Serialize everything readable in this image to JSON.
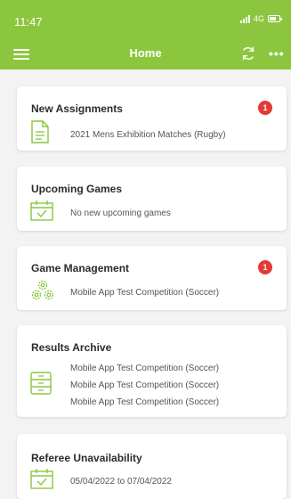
{
  "status_bar": {
    "time": "11:47",
    "network": "4G"
  },
  "header": {
    "title": "Home"
  },
  "colors": {
    "accent": "#8cc63f",
    "badge": "#e53935"
  },
  "cards": [
    {
      "title": "New Assignments",
      "badge": "1",
      "icon": "document-icon",
      "items": [
        "2021 Mens Exhibition Matches (Rugby)"
      ]
    },
    {
      "title": "Upcoming Games",
      "icon": "calendar-check-icon",
      "items": [
        "No new upcoming games"
      ]
    },
    {
      "title": "Game Management",
      "badge": "1",
      "icon": "gears-icon",
      "items": [
        "Mobile App Test Competition (Soccer)"
      ]
    },
    {
      "title": "Results Archive",
      "icon": "archive-icon",
      "items": [
        "Mobile App Test Competition (Soccer)",
        "Mobile App Test Competition (Soccer)",
        "Mobile App Test Competition (Soccer)"
      ]
    },
    {
      "title": "Referee Unavailability",
      "icon": "calendar-check-icon",
      "items": [
        "05/04/2022 to 07/04/2022"
      ]
    }
  ]
}
